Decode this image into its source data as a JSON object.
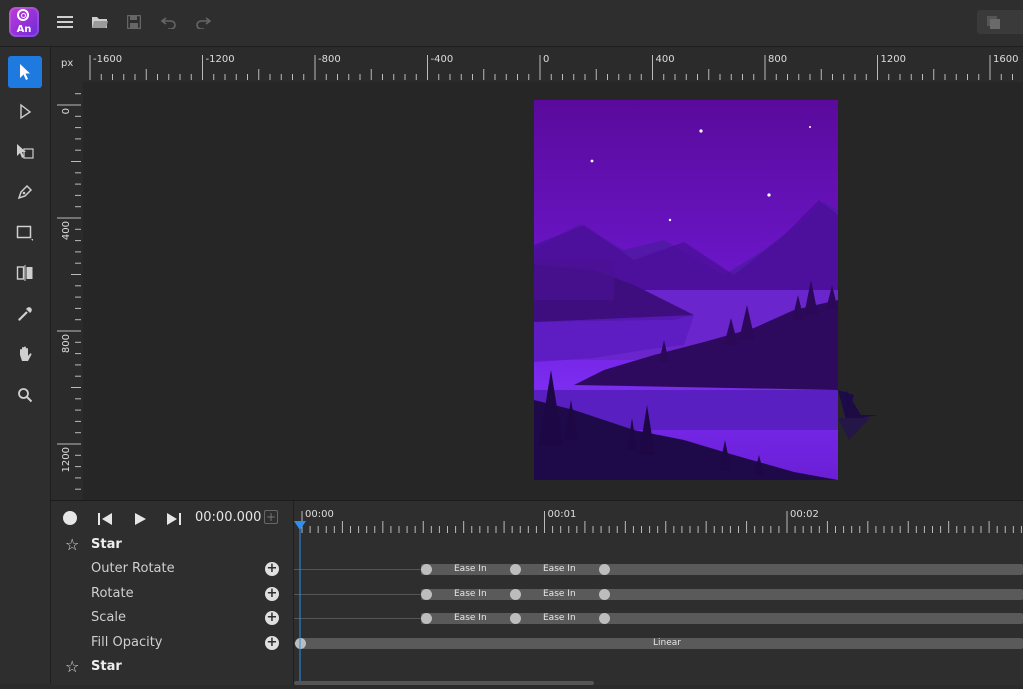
{
  "app": {
    "logo_text": "An"
  },
  "toolbar": {
    "icons": [
      "menu-icon",
      "open-folder-icon",
      "save-icon",
      "undo-icon",
      "redo-icon"
    ]
  },
  "tools": [
    {
      "name": "select-tool",
      "icon": "arrow-icon",
      "active": true
    },
    {
      "name": "direct-select-tool",
      "icon": "hollow-arrow-icon",
      "active": false
    },
    {
      "name": "transform-tool",
      "icon": "transform-icon",
      "active": false
    },
    {
      "name": "pen-tool",
      "icon": "pen-icon",
      "active": false
    },
    {
      "name": "rectangle-tool",
      "icon": "rectangle-icon",
      "active": false
    },
    {
      "name": "mirror-tool",
      "icon": "mirror-icon",
      "active": false
    },
    {
      "name": "eyedropper-tool",
      "icon": "eyedropper-icon",
      "active": false
    },
    {
      "name": "hand-tool",
      "icon": "hand-icon",
      "active": false
    },
    {
      "name": "zoom-tool",
      "icon": "magnifier-icon",
      "active": false
    }
  ],
  "ruler": {
    "unit": "px",
    "top_labels": [
      "-1600",
      "-1200",
      "-800",
      "-400",
      "0",
      "400",
      "800",
      "1200",
      "1600"
    ],
    "left_labels": [
      "0",
      "400",
      "800",
      "1200"
    ]
  },
  "timeline": {
    "time": "00:00.000",
    "ruler_labels": [
      "00:00",
      "00:01",
      "00:02"
    ],
    "rows": [
      {
        "label": "Star",
        "type": "group"
      },
      {
        "label": "Outer Rotate",
        "type": "prop",
        "segments": [
          "Ease In",
          "Ease In"
        ]
      },
      {
        "label": "Rotate",
        "type": "prop",
        "segments": [
          "Ease In",
          "Ease In"
        ]
      },
      {
        "label": "Scale",
        "type": "prop",
        "segments": [
          "Ease In",
          "Ease In"
        ]
      },
      {
        "label": "Fill Opacity",
        "type": "prop",
        "segments": [
          "Linear"
        ]
      },
      {
        "label": "Star",
        "type": "group"
      }
    ]
  },
  "colors": {
    "accent": "#1f7ae0",
    "artboard_top": "#5b0fa0",
    "artboard_mid": "#7a2be8"
  }
}
